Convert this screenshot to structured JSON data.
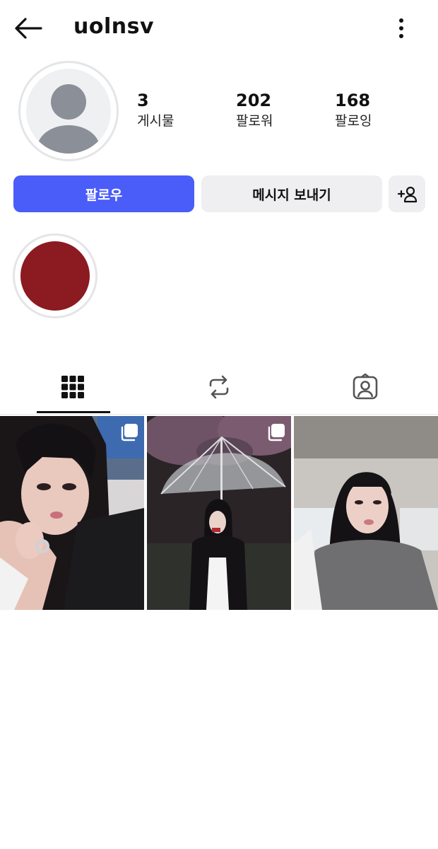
{
  "header": {
    "username": "uolnsv"
  },
  "profile": {
    "stats": [
      {
        "value": "3",
        "label": "게시물"
      },
      {
        "value": "202",
        "label": "팔로워"
      },
      {
        "value": "168",
        "label": "팔로잉"
      }
    ]
  },
  "actions": {
    "follow_label": "팔로우",
    "message_label": "메시지 보내기",
    "suggest_icon": "add-person-icon"
  },
  "highlights": [
    {
      "color": "#8b1a21"
    }
  ],
  "tabs": [
    {
      "icon": "grid-icon",
      "active": true
    },
    {
      "icon": "repost-icon",
      "active": false
    },
    {
      "icon": "tagged-icon",
      "active": false
    }
  ],
  "posts": [
    {
      "multi": true
    },
    {
      "multi": true
    },
    {
      "multi": false
    }
  ],
  "colors": {
    "accent": "#4a5df9",
    "secondary_button": "#efeff2",
    "highlight": "#8b1a21"
  }
}
